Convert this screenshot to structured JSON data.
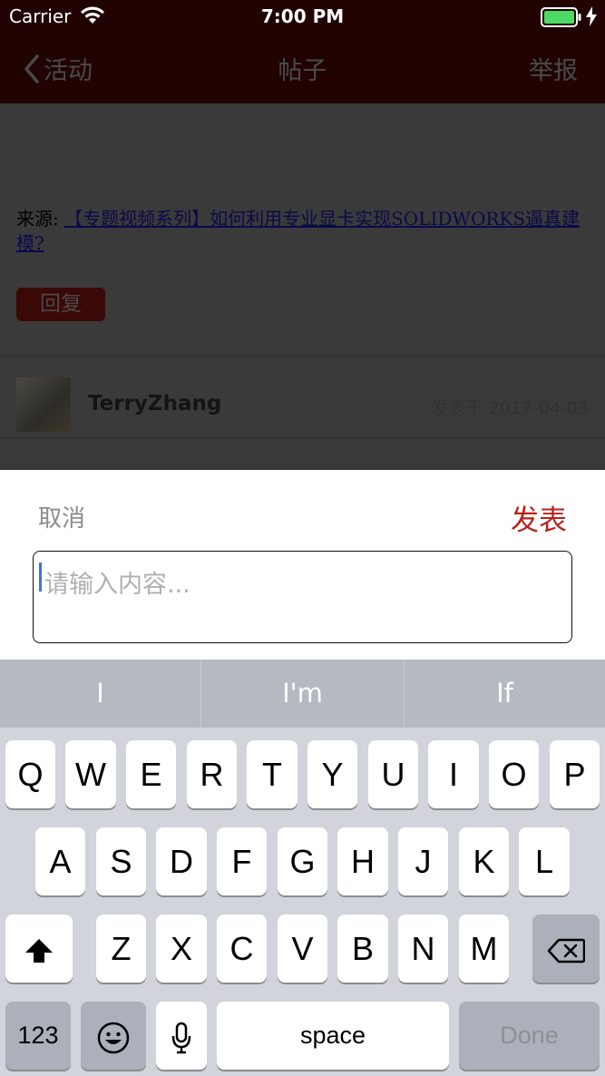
{
  "status": {
    "carrier": "Carrier",
    "time": "7:00 PM"
  },
  "nav": {
    "back_label": "活动",
    "title": "帖子",
    "report_label": "举报"
  },
  "post": {
    "source_prefix": "来源: ",
    "source_link": "【专题视频系列】如何利用专业显卡实现SOLIDWORKS逼真建模?",
    "reply_label": "回复",
    "author": "TerryZhang",
    "published": "发表于 2017-04-03"
  },
  "compose": {
    "cancel_label": "取消",
    "submit_label": "发表",
    "placeholder": "请输入内容..."
  },
  "keyboard": {
    "suggestions": [
      "I",
      "I'm",
      "If"
    ],
    "row1": [
      "Q",
      "W",
      "E",
      "R",
      "T",
      "Y",
      "U",
      "I",
      "O",
      "P"
    ],
    "row2": [
      "A",
      "S",
      "D",
      "F",
      "G",
      "H",
      "J",
      "K",
      "L"
    ],
    "row3": [
      "Z",
      "X",
      "C",
      "V",
      "B",
      "N",
      "M"
    ],
    "numbers_label": "123",
    "space_label": "space",
    "done_label": "Done"
  },
  "colors": {
    "nav_background": "#210402",
    "accent_red": "#b5231d",
    "caret_blue": "#3d73e6",
    "battery_green": "#4cd964"
  }
}
